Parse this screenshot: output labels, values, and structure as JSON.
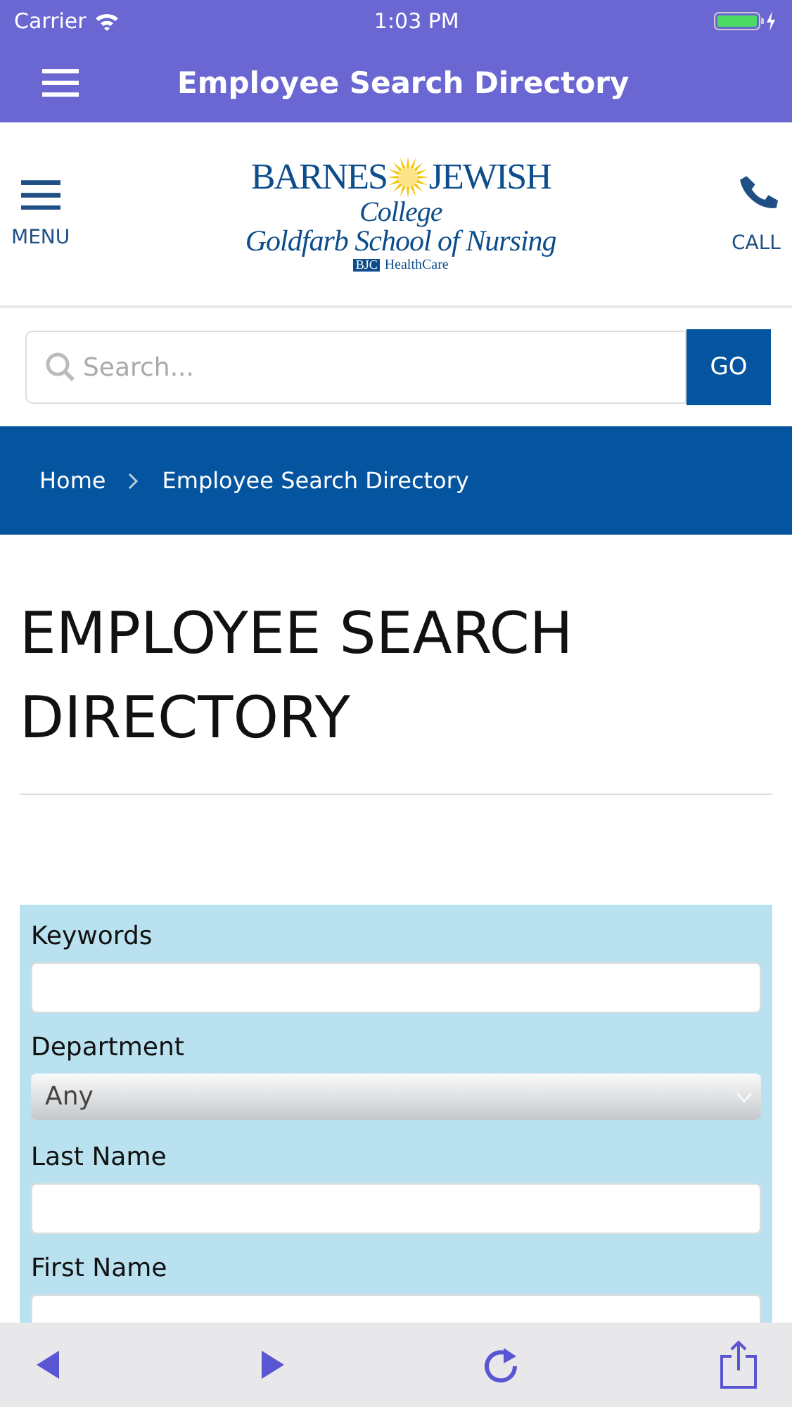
{
  "status_bar": {
    "carrier": "Carrier",
    "time": "1:03 PM"
  },
  "nav_bar": {
    "title": "Employee Search Directory"
  },
  "header": {
    "menu_label": "MENU",
    "call_label": "CALL",
    "logo": {
      "word_1": "BARNES",
      "word_2": "JEWISH",
      "line_2": "College",
      "line_3": "Goldfarb School of Nursing",
      "badge": "BJC",
      "tagline": "HealthCare"
    }
  },
  "search": {
    "placeholder": "Search...",
    "button": "GO"
  },
  "breadcrumb": [
    {
      "label": "Home"
    },
    {
      "label": "Employee Search Directory"
    }
  ],
  "page_title": "EMPLOYEE SEARCH DIRECTORY",
  "form": {
    "fields": [
      {
        "kind": "text",
        "label": "Keywords"
      },
      {
        "kind": "select",
        "label": "Department",
        "value": "Any"
      },
      {
        "kind": "text",
        "label": "Last Name"
      },
      {
        "kind": "text",
        "label": "First Name"
      }
    ]
  }
}
